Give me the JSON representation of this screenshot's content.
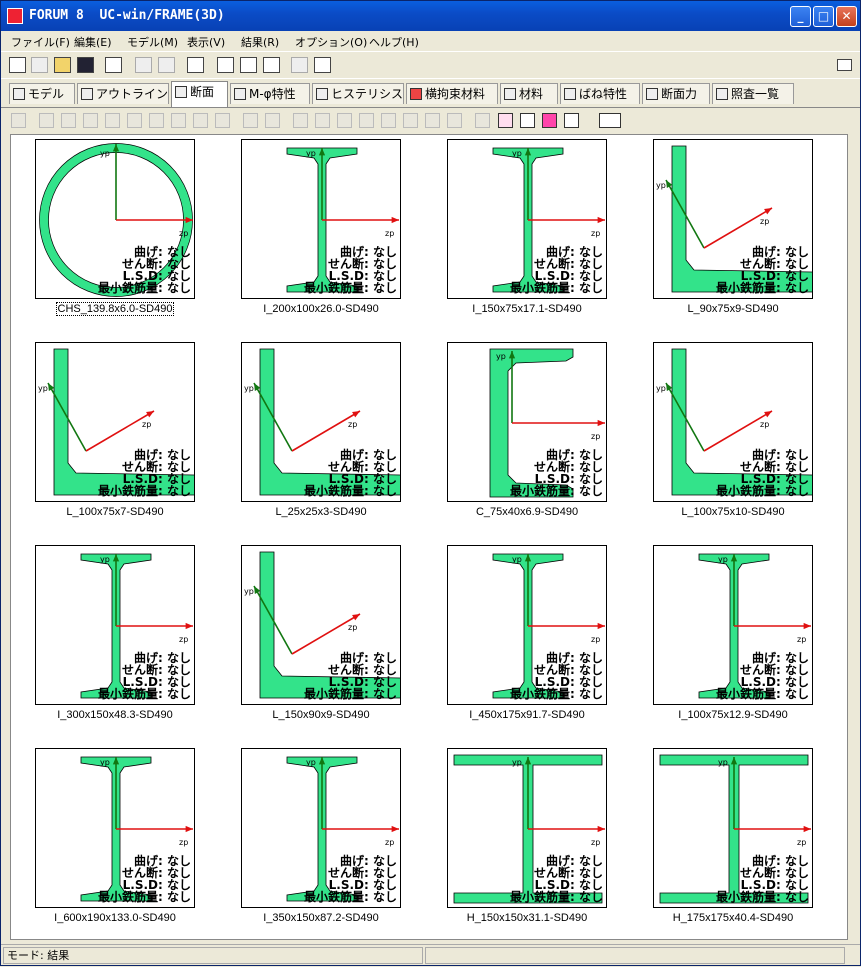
{
  "window": {
    "title": "FORUM 8  UC-win/FRAME(3D)",
    "minimize": "_",
    "maximize": "□",
    "close": "✕"
  },
  "menu": [
    "ファイル(F)",
    "編集(E)",
    "モデル(M)",
    "表示(V)",
    "結果(R)",
    "オプション(O)",
    "ヘルプ(H)"
  ],
  "tabs": [
    "モデル",
    "アウトライン",
    "断面",
    "M-φ特性",
    "ヒステリシス",
    "横拘束材料",
    "材料",
    "ばね特性",
    "断面力",
    "照査一覧"
  ],
  "active_tab": "断面",
  "axis_labels": {
    "y": "yp",
    "z": "zp"
  },
  "annotation": {
    "bending": "曲げ: なし",
    "shear": "せん断: なし",
    "lsd": "L.S.D: なし",
    "min_rebar": "最小鉄筋量: なし"
  },
  "sections": [
    {
      "name": "CHS_139.8x6.0-SD490",
      "shape": "circle",
      "selected": true
    },
    {
      "name": "I_200x100x26.0-SD490",
      "shape": "i-taper"
    },
    {
      "name": "I_150x75x17.1-SD490",
      "shape": "i-taper"
    },
    {
      "name": "L_90x75x9-SD490",
      "shape": "angle"
    },
    {
      "name": "L_100x75x7-SD490",
      "shape": "angle"
    },
    {
      "name": "L_25x25x3-SD490",
      "shape": "angle"
    },
    {
      "name": "C_75x40x6.9-SD490",
      "shape": "channel"
    },
    {
      "name": "L_100x75x10-SD490",
      "shape": "angle"
    },
    {
      "name": "I_300x150x48.3-SD490",
      "shape": "i-taper"
    },
    {
      "name": "L_150x90x9-SD490",
      "shape": "angle"
    },
    {
      "name": "I_450x175x91.7-SD490",
      "shape": "i-taper"
    },
    {
      "name": "I_100x75x12.9-SD490",
      "shape": "i-taper"
    },
    {
      "name": "I_600x190x133.0-SD490",
      "shape": "i-taper"
    },
    {
      "name": "I_350x150x87.2-SD490",
      "shape": "i-taper"
    },
    {
      "name": "H_150x150x31.1-SD490",
      "shape": "h"
    },
    {
      "name": "H_175x175x40.4-SD490",
      "shape": "h"
    }
  ],
  "status": {
    "mode": "モード: 結果"
  },
  "colors": {
    "section_fill": "#33E38A",
    "y_axis": "#117711",
    "z_axis": "#E01010",
    "titlebar": "#0B4CC7"
  }
}
